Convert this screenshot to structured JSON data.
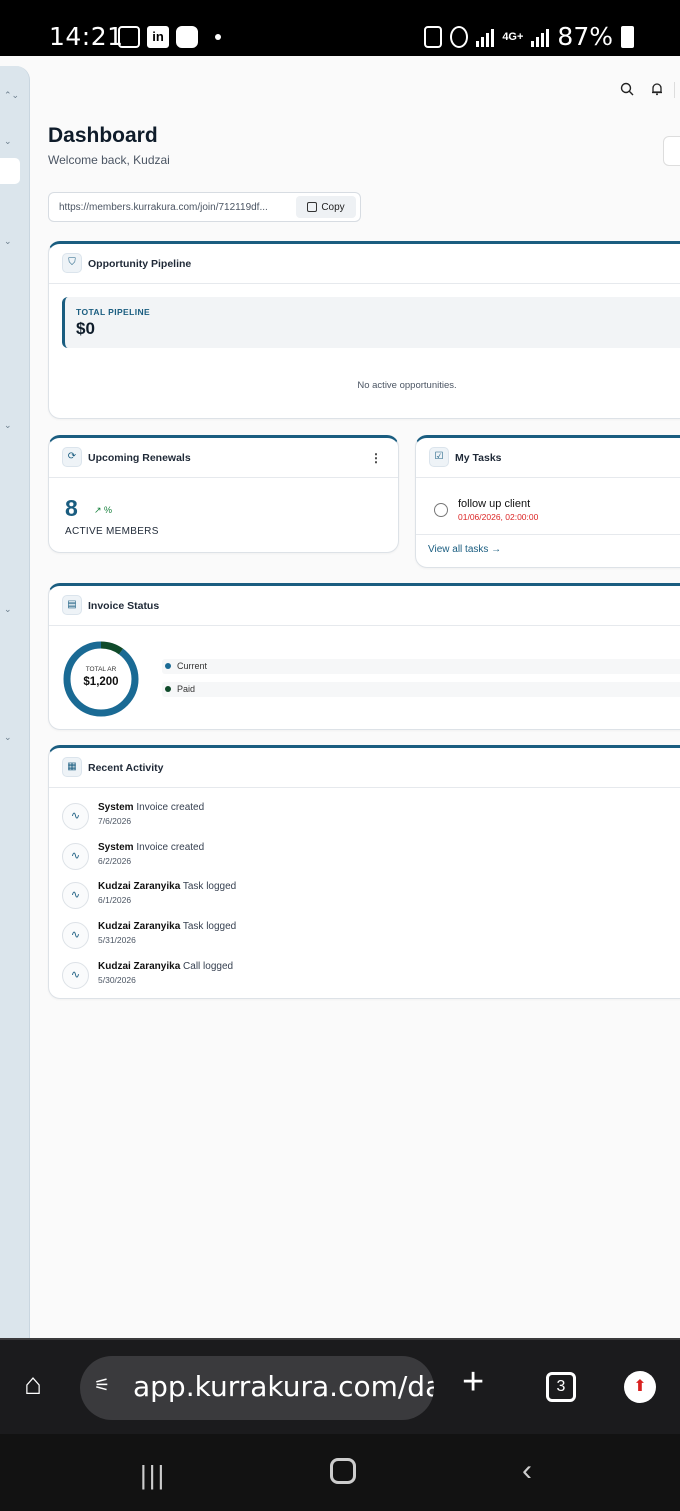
{
  "status_bar": {
    "time": "14:21",
    "linkedin": "in",
    "network": "4G+",
    "battery": "87%"
  },
  "topbar": {
    "search_icon": "search-icon",
    "bell_icon": "bell-icon"
  },
  "page": {
    "title": "Dashboard",
    "subtitle": "Welcome back, Kudzai"
  },
  "join_link": {
    "url": "https://members.kurrakura.com/join/712119df...",
    "copy_label": "Copy"
  },
  "pipeline": {
    "title": "Opportunity Pipeline",
    "total_label": "TOTAL PIPELINE",
    "total_value": "$0",
    "empty_text": "No active opportunities."
  },
  "renewals": {
    "title": "Upcoming Renewals",
    "count": "8",
    "trend": "↗ %",
    "label": "ACTIVE MEMBERS"
  },
  "tasks": {
    "title": "My Tasks",
    "items": [
      {
        "name": "follow up client",
        "due": "01/06/2026, 02:00:00"
      }
    ],
    "view_all": "View all tasks →"
  },
  "invoices": {
    "title": "Invoice Status",
    "total_label": "TOTAL AR",
    "total_value": "$1,200",
    "current_fraction": 0.9,
    "paid_fraction": 0.1,
    "legend": [
      {
        "label": "Current",
        "color": "#1a6a94"
      },
      {
        "label": "Paid",
        "color": "#0f4a2a"
      }
    ]
  },
  "activity": {
    "title": "Recent Activity",
    "items": [
      {
        "actor": "System",
        "action": "Invoice created",
        "date": "7/6/2026"
      },
      {
        "actor": "System",
        "action": "Invoice created",
        "date": "6/2/2026"
      },
      {
        "actor": "Kudzai Zaranyika",
        "action": "Task logged",
        "date": "6/1/2026"
      },
      {
        "actor": "Kudzai Zaranyika",
        "action": "Task logged",
        "date": "5/31/2026"
      },
      {
        "actor": "Kudzai Zaranyika",
        "action": "Call logged",
        "date": "5/30/2026"
      }
    ]
  },
  "browser": {
    "url": "app.kurrakura.com/da",
    "tab_count": "3"
  },
  "colors": {
    "accent": "#1a5d80",
    "danger": "#dc2626",
    "success": "#16803c"
  }
}
